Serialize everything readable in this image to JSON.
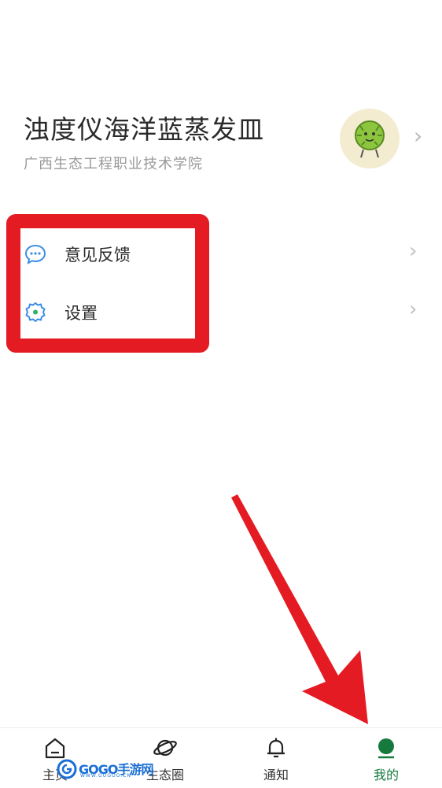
{
  "profile": {
    "name": "浊度仪海洋蓝蒸发皿",
    "school": "广西生态工程职业技术学院"
  },
  "menu": [
    {
      "label": "意见反馈",
      "icon": "chat-bubble-icon"
    },
    {
      "label": "设置",
      "icon": "gear-icon"
    }
  ],
  "tabs": [
    {
      "label": "主页",
      "icon": "home-icon"
    },
    {
      "label": "生态圈",
      "icon": "planet-icon"
    },
    {
      "label": "通知",
      "icon": "bell-icon"
    },
    {
      "label": "我的",
      "icon": "profile-dot-icon",
      "active": true
    }
  ],
  "watermark": {
    "text": "GOGO手游网",
    "sub": "WWW.GOGOO.CN"
  },
  "colors": {
    "accent": "#167a3e",
    "annotation": "#e51b23",
    "icon_blue": "#3a8ee6"
  }
}
